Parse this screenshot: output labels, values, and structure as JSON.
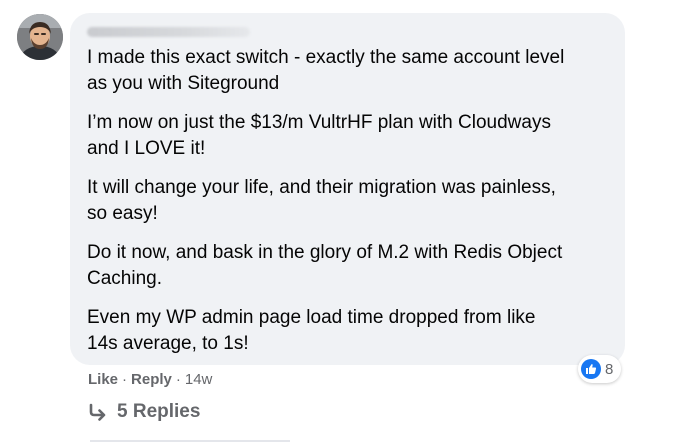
{
  "comment": {
    "paragraphs": [
      "I made this exact switch - exactly the same account level\nas you with Siteground",
      "I’m now on just the $13/m VultrHF plan with Cloudways\nand I LOVE it!",
      "It will change your life, and their migration was painless,\nso easy!",
      "Do it now, and bask in the glory of M.2 with Redis Object\nCaching.",
      "Even my WP admin page load time dropped from like\n14s average, to 1s!"
    ],
    "reaction_icon": "like-thumb-icon",
    "reaction_count": "8",
    "like_label": "Like",
    "reply_label": "Reply",
    "separator": "·",
    "timestamp": "14w"
  },
  "replies": {
    "icon": "reply-arrow-icon",
    "label": "5 Replies"
  },
  "colors": {
    "bubble": "#f0f2f5",
    "text": "#050505",
    "secondary": "#65676b",
    "like_blue": "#1877f2"
  }
}
